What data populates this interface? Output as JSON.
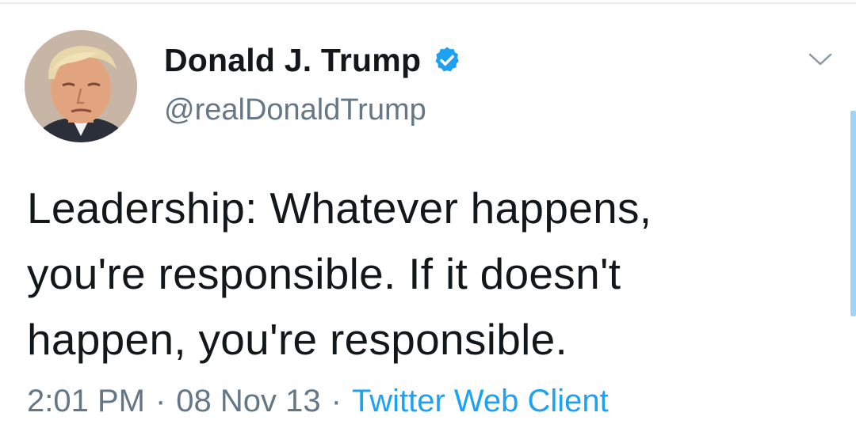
{
  "tweet": {
    "author": {
      "display_name": "Donald J. Trump",
      "handle": "@realDonaldTrump",
      "verified": true,
      "avatar_icon": "profile-photo"
    },
    "text_lines": [
      "Leadership: Whatever happens,",
      "you're responsible. If it doesn't",
      "happen, you're responsible."
    ],
    "time": "2:01 PM",
    "date": "08 Nov 13",
    "separator": "·",
    "source": "Twitter Web Client",
    "menu_icon": "chevron-down-icon"
  },
  "colors": {
    "text_primary": "#14171a",
    "text_secondary": "#657786",
    "accent_blue": "#1da1f2",
    "divider": "#e6ecf0"
  }
}
